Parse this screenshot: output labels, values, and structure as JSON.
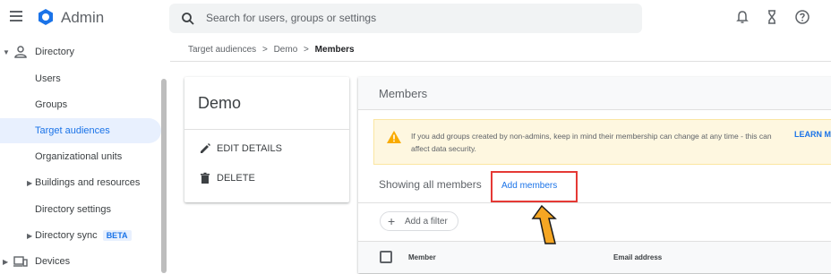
{
  "app": {
    "name": "Admin",
    "brand_color": "#1a73e8"
  },
  "search": {
    "placeholder": "Search for users, groups or settings"
  },
  "top_icons": [
    "bell-icon",
    "hourglass-icon",
    "help-icon"
  ],
  "sidebar": {
    "directory": "Directory",
    "items": [
      {
        "label": "Users"
      },
      {
        "label": "Groups"
      },
      {
        "label": "Target audiences",
        "active": true
      },
      {
        "label": "Organizational units"
      },
      {
        "label": "Buildings and resources"
      },
      {
        "label": "Directory settings"
      },
      {
        "label": "Directory sync",
        "badge": "BETA"
      }
    ],
    "devices": "Devices"
  },
  "breadcrumb": {
    "part1": "Target audiences",
    "sep": ">",
    "part2": "Demo",
    "current": "Members"
  },
  "group_card": {
    "name": "Demo",
    "edit_label": "EDIT DETAILS",
    "delete_label": "DELETE"
  },
  "members_panel": {
    "title": "Members",
    "warning": "If you add groups created by non-admins, keep in mind their membership can change at any time - this can affect data security.",
    "learn_more": "LEARN MOR",
    "showing": "Showing all members",
    "add_members": "Add members",
    "add_filter": "Add a filter",
    "columns": {
      "member": "Member",
      "email": "Email address"
    }
  },
  "colors": {
    "highlight_box": "#e53935",
    "arrow": "#f5a623",
    "warning_bg": "#fef7e0"
  }
}
